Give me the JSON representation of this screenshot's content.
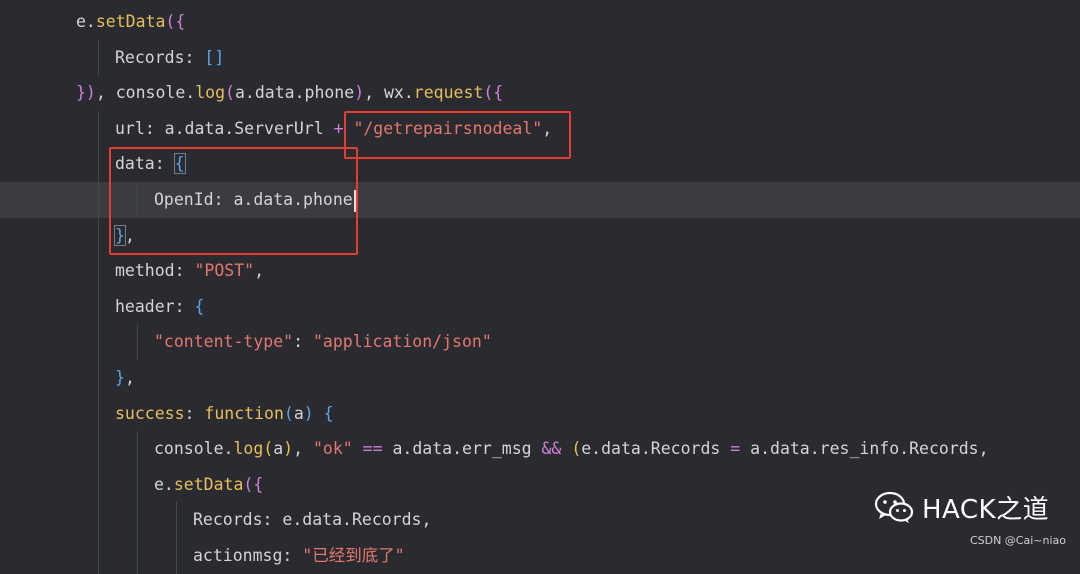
{
  "lines": [
    {
      "indent": 2,
      "current": false,
      "tokens": [
        {
          "t": "e.",
          "c": "v"
        },
        {
          "t": "setData",
          "c": "fn"
        },
        {
          "t": "({",
          "c": "br2"
        }
      ]
    },
    {
      "indent": 3,
      "current": false,
      "tokens": [
        {
          "t": "Records",
          "c": "v"
        },
        {
          "t": ": ",
          "c": "v"
        },
        {
          "t": "[]",
          "c": "br3"
        }
      ]
    },
    {
      "indent": 2,
      "current": false,
      "tokens": [
        {
          "t": "})",
          "c": "br2"
        },
        {
          "t": ", console.",
          "c": "v"
        },
        {
          "t": "log",
          "c": "fn"
        },
        {
          "t": "(",
          "c": "br2"
        },
        {
          "t": "a.data.phone",
          "c": "v"
        },
        {
          "t": ")",
          "c": "br2"
        },
        {
          "t": ", wx.",
          "c": "v"
        },
        {
          "t": "request",
          "c": "fn"
        },
        {
          "t": "({",
          "c": "br2"
        }
      ]
    },
    {
      "indent": 3,
      "current": false,
      "tokens": [
        {
          "t": "url",
          "c": "v"
        },
        {
          "t": ": a.data.ServerUrl ",
          "c": "v"
        },
        {
          "t": "+",
          "c": "op"
        },
        {
          "t": " ",
          "c": "v"
        },
        {
          "t": "\"/getrepairsnodeal\"",
          "c": "str"
        },
        {
          "t": ",",
          "c": "v"
        }
      ]
    },
    {
      "indent": 3,
      "current": false,
      "tokens": [
        {
          "t": "data",
          "c": "v"
        },
        {
          "t": ": ",
          "c": "v"
        },
        {
          "t": "{",
          "c": "br3",
          "box": true
        }
      ]
    },
    {
      "indent": 4,
      "current": true,
      "cursor": true,
      "tokens": [
        {
          "t": "OpenId",
          "c": "v"
        },
        {
          "t": ": a.data.phone",
          "c": "v"
        }
      ]
    },
    {
      "indent": 3,
      "current": false,
      "tokens": [
        {
          "t": "}",
          "c": "br3",
          "box": true
        },
        {
          "t": ",",
          "c": "v"
        }
      ]
    },
    {
      "indent": 3,
      "current": false,
      "tokens": [
        {
          "t": "method",
          "c": "v"
        },
        {
          "t": ": ",
          "c": "v"
        },
        {
          "t": "\"POST\"",
          "c": "str"
        },
        {
          "t": ",",
          "c": "v"
        }
      ]
    },
    {
      "indent": 3,
      "current": false,
      "tokens": [
        {
          "t": "header",
          "c": "v"
        },
        {
          "t": ": ",
          "c": "v"
        },
        {
          "t": "{",
          "c": "br3"
        }
      ]
    },
    {
      "indent": 4,
      "current": false,
      "tokens": [
        {
          "t": "\"content-type\"",
          "c": "str"
        },
        {
          "t": ": ",
          "c": "v"
        },
        {
          "t": "\"application/json\"",
          "c": "str"
        }
      ]
    },
    {
      "indent": 3,
      "current": false,
      "tokens": [
        {
          "t": "}",
          "c": "br3"
        },
        {
          "t": ",",
          "c": "v"
        }
      ]
    },
    {
      "indent": 3,
      "current": false,
      "tokens": [
        {
          "t": "success",
          "c": "fn"
        },
        {
          "t": ": ",
          "c": "v"
        },
        {
          "t": "function",
          "c": "kw"
        },
        {
          "t": "(",
          "c": "br3"
        },
        {
          "t": "a",
          "c": "v"
        },
        {
          "t": ")",
          "c": "br3"
        },
        {
          "t": " ",
          "c": "v"
        },
        {
          "t": "{",
          "c": "br3"
        }
      ]
    },
    {
      "indent": 4,
      "current": false,
      "tokens": [
        {
          "t": "console.",
          "c": "v"
        },
        {
          "t": "log",
          "c": "fn"
        },
        {
          "t": "(",
          "c": "br1"
        },
        {
          "t": "a",
          "c": "v"
        },
        {
          "t": ")",
          "c": "br1"
        },
        {
          "t": ", ",
          "c": "v"
        },
        {
          "t": "\"ok\"",
          "c": "str"
        },
        {
          "t": " == ",
          "c": "op"
        },
        {
          "t": "a.data.err_msg ",
          "c": "v"
        },
        {
          "t": "&&",
          "c": "op"
        },
        {
          "t": " ",
          "c": "v"
        },
        {
          "t": "(",
          "c": "br1"
        },
        {
          "t": "e.data.Records ",
          "c": "v"
        },
        {
          "t": "=",
          "c": "op"
        },
        {
          "t": " a.data.res_info.Records,",
          "c": "v"
        }
      ]
    },
    {
      "indent": 4,
      "current": false,
      "tokens": [
        {
          "t": "e.",
          "c": "v"
        },
        {
          "t": "setData",
          "c": "fn"
        },
        {
          "t": "({",
          "c": "br2"
        }
      ]
    },
    {
      "indent": 5,
      "current": false,
      "tokens": [
        {
          "t": "Records",
          "c": "v"
        },
        {
          "t": ": e.data.Records,",
          "c": "v"
        }
      ]
    },
    {
      "indent": 5,
      "current": false,
      "tokens": [
        {
          "t": "actionmsg",
          "c": "v"
        },
        {
          "t": ": ",
          "c": "v"
        },
        {
          "t": "\"已经到底了\"",
          "c": "str"
        }
      ]
    }
  ],
  "watermark": {
    "text": "HACK之道",
    "icon": "wechat-icon"
  },
  "credit": "CSDN @Cai~niao",
  "colors": {
    "background": "#292b30",
    "current_line": "#3a3c42",
    "highlight_box": "#e53d30"
  }
}
